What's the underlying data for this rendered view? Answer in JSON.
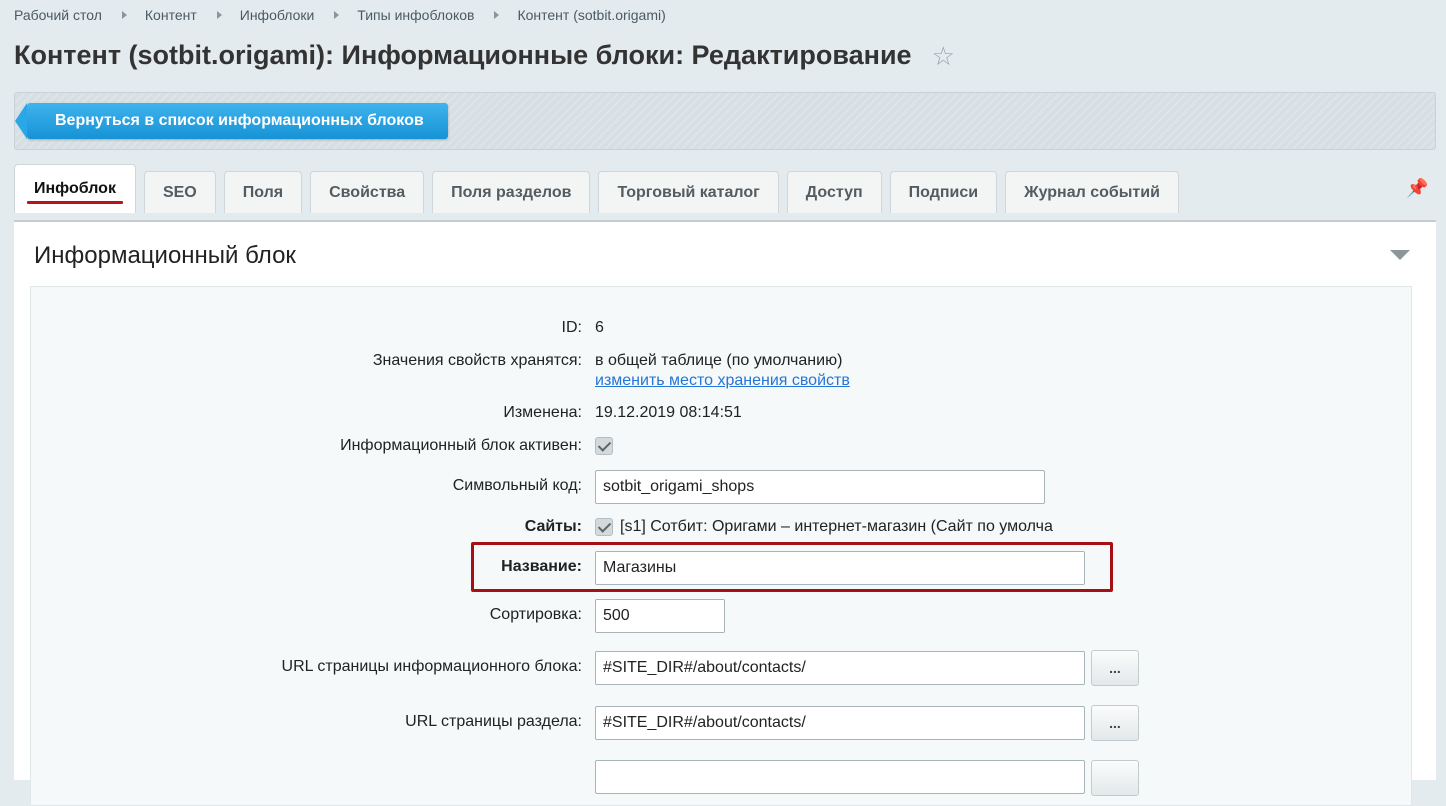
{
  "breadcrumb": [
    "Рабочий стол",
    "Контент",
    "Инфоблоки",
    "Типы инфоблоков",
    "Контент (sotbit.origami)"
  ],
  "page_title": "Контент (sotbit.origami): Информационные блоки: Редактирование",
  "back_button": "Вернуться в список информационных блоков",
  "tabs": [
    "Инфоблок",
    "SEO",
    "Поля",
    "Свойства",
    "Поля разделов",
    "Торговый каталог",
    "Доступ",
    "Подписи",
    "Журнал событий"
  ],
  "section_title": "Информационный блок",
  "form": {
    "id_label": "ID:",
    "id_value": "6",
    "storage_label": "Значения свойств хранятся:",
    "storage_value": "в общей таблице (по умолчанию)",
    "storage_link": "изменить место хранения свойств",
    "modified_label": "Изменена:",
    "modified_value": "19.12.2019 08:14:51",
    "active_label": "Информационный блок активен:",
    "code_label": "Символьный код:",
    "code_value": "sotbit_origami_shops",
    "sites_label": "Сайты:",
    "sites_value": "[s1] Сотбит: Оригами – интернет-магазин (Сайт по умолча",
    "name_label": "Название:",
    "name_value": "Магазины",
    "sort_label": "Сортировка:",
    "sort_value": "500",
    "iblock_url_label": "URL страницы информационного блока:",
    "iblock_url_value": "#SITE_DIR#/about/contacts/",
    "section_url_label": "URL страницы раздела:",
    "section_url_value": "#SITE_DIR#/about/contacts/",
    "browse_label": "..."
  },
  "colors": {
    "accent_blue": "#1d9fe2",
    "highlight_red": "#a51015",
    "tab_underline": "#b9141c"
  }
}
